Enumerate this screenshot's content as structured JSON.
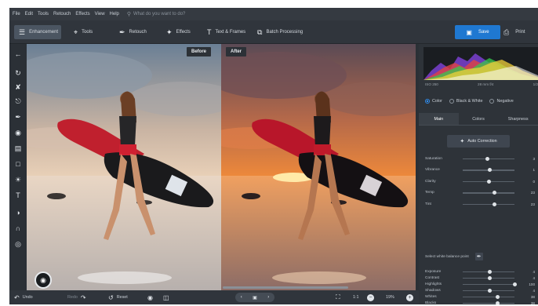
{
  "menu": {
    "items": [
      "File",
      "Edit",
      "Tools",
      "Retouch",
      "Effects",
      "View",
      "Help"
    ],
    "search_placeholder": "What do you want to do?"
  },
  "toolbar": {
    "tabs": [
      {
        "label": "Enhancement",
        "icon": "sliders-icon"
      },
      {
        "label": "Tools",
        "icon": "crop-icon"
      },
      {
        "label": "Retouch",
        "icon": "brush-icon"
      },
      {
        "label": "Effects",
        "icon": "wand-icon"
      },
      {
        "label": "Text & Frames",
        "icon": "text-icon"
      },
      {
        "label": "Batch Processing",
        "icon": "batch-icon"
      }
    ],
    "save_label": "Save",
    "print_label": "Print"
  },
  "compare": {
    "before_label": "Before",
    "after_label": "After"
  },
  "histogram": {
    "info": [
      "ISO 250",
      "28 mm f/4",
      "1/2"
    ]
  },
  "modes": {
    "color": "Color",
    "bw": "Black & White",
    "negative": "Negative",
    "selected": "Color"
  },
  "tabs": {
    "main": "Main",
    "colors": "Colors",
    "sharpness": "Sharpness"
  },
  "auto_correction": "Auto Correction",
  "sliders_top": [
    {
      "label": "Saturation",
      "value": "3",
      "pos": 0.48
    },
    {
      "label": "Vibrance",
      "value": "1",
      "pos": 0.52
    },
    {
      "label": "Clarity",
      "value": "0",
      "pos": 0.5
    },
    {
      "label": "Temp",
      "value": "23",
      "pos": 0.62
    },
    {
      "label": "Tint",
      "value": "23",
      "pos": 0.62
    }
  ],
  "white_balance_label": "Select white balance point",
  "sliders_bottom": [
    {
      "label": "Exposure",
      "value": "4",
      "pos": 0.52
    },
    {
      "label": "Contrast",
      "value": "4",
      "pos": 0.52
    },
    {
      "label": "Highlights",
      "value": "100",
      "pos": 1.0
    },
    {
      "label": "Shadows",
      "value": "4",
      "pos": 0.52
    },
    {
      "label": "Whites",
      "value": "38",
      "pos": 0.68
    },
    {
      "label": "Blacks",
      "value": "38",
      "pos": 0.68
    }
  ],
  "bottombar": {
    "undo": "Undo",
    "redo": "Redo",
    "reset": "Reset",
    "ratio": "1:1",
    "zoom": "19%"
  }
}
